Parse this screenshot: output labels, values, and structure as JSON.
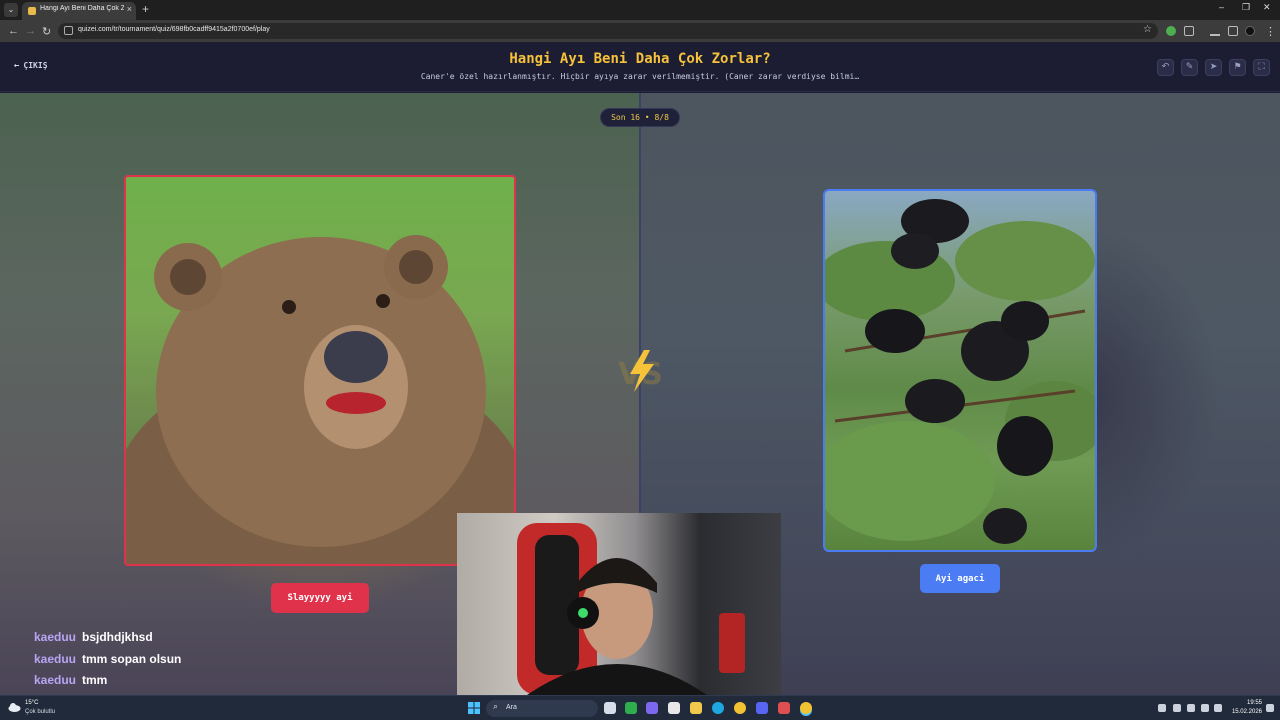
{
  "browser": {
    "tab_title": "Hangi Ayı Beni Daha Çok Zorlar",
    "url": "quizei.com/tr/tournament/quiz/698fb0cadff9415a2f0700ef/play"
  },
  "header": {
    "back_label": "ÇIKIŞ",
    "title": "Hangi Ayı Beni Daha Çok Zorlar?",
    "subtitle": "Caner'e özel hazırlanmıştır. Hiçbir ayıya zarar verilmemiştir. (Caner zarar verdiyse bilmi…"
  },
  "round": {
    "label": "Son 16 • 8/8"
  },
  "choices": {
    "left": {
      "label": "Slayyyyy ayi",
      "icon": "grizzly-bear-photo"
    },
    "right": {
      "label": "Ayi agaci",
      "icon": "bears-in-tree-photo"
    }
  },
  "chat": [
    {
      "user": "kaeduu",
      "message": "bsjdhdjkhsd"
    },
    {
      "user": "kaeduu",
      "message": "tmm sopan olsun"
    },
    {
      "user": "kaeduu",
      "message": "tmm"
    }
  ],
  "taskbar": {
    "weather_temp": "15°C",
    "weather_desc": "Çok bulutlu",
    "search_label": "Ara",
    "time": "19:55",
    "date": "15.02.2026"
  },
  "colors": {
    "accent_title": "#f5c23a",
    "left_choice": "#e0334b",
    "right_choice": "#4b7cf3"
  }
}
